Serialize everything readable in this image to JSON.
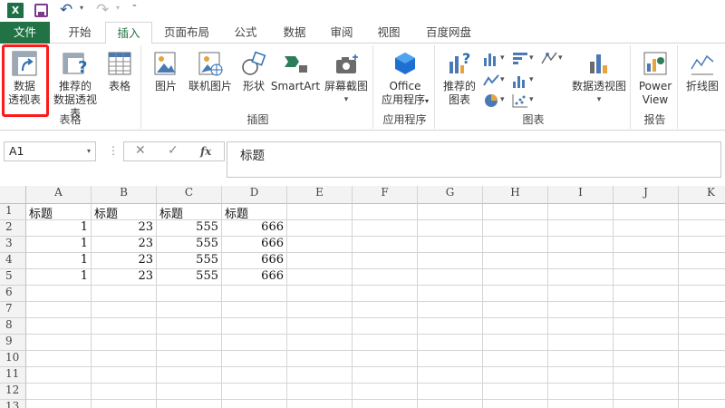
{
  "qat": {
    "app_icon": "X",
    "undo_glyph": "↶",
    "redo_glyph": "↷",
    "dropdown_glyph": "▾",
    "custom_glyph": "⁼"
  },
  "tabs": [
    "文件",
    "开始",
    "插入",
    "页面布局",
    "公式",
    "数据",
    "审阅",
    "视图",
    "百度网盘"
  ],
  "ribbon": {
    "groups": {
      "tables": "表格",
      "illustrations": "插图",
      "apps": "应用程序",
      "charts": "图表",
      "reports": "报告"
    },
    "buttons": {
      "pivot_table": [
        "数据",
        "透视表"
      ],
      "recommended_pivot": [
        "推荐的",
        "数据透视表"
      ],
      "table": "表格",
      "pictures": "图片",
      "online_pictures": "联机图片",
      "shapes": "形状",
      "smartart": "SmartArt",
      "screenshot": "屏幕截图",
      "office_apps": [
        "Office",
        "应用程序"
      ],
      "recommended_charts": [
        "推荐的",
        "图表"
      ],
      "pivot_chart": "数据透视图",
      "power_view": [
        "Power",
        "View"
      ],
      "line_sparkline": "折线图"
    }
  },
  "formula_bar": {
    "name_box": "A1",
    "cancel_glyph": "✕",
    "enter_glyph": "✓",
    "fx_label": "fx",
    "content": "标题",
    "separator": "⋮"
  },
  "sheet": {
    "columns": [
      "A",
      "B",
      "C",
      "D",
      "E",
      "F",
      "G",
      "H",
      "I",
      "J",
      "K"
    ],
    "rows": [
      "1",
      "2",
      "3",
      "4",
      "5",
      "6",
      "7",
      "8",
      "9",
      "10",
      "11",
      "12",
      "13"
    ],
    "cells": [
      [
        "标题",
        "标题",
        "标题",
        "标题"
      ],
      [
        "1",
        "23",
        "555",
        "666"
      ],
      [
        "1",
        "23",
        "555",
        "666"
      ],
      [
        "1",
        "23",
        "555",
        "666"
      ],
      [
        "1",
        "23",
        "555",
        "666"
      ]
    ]
  },
  "colors": {
    "excel_green": "#217346",
    "highlight_red": "#ff1a1a"
  }
}
